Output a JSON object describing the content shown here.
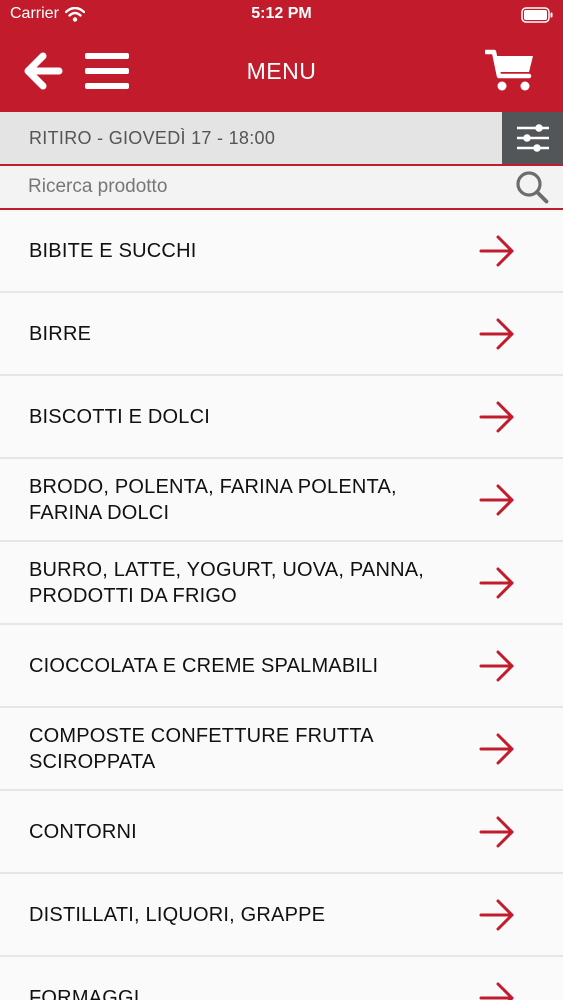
{
  "status_bar": {
    "carrier": "Carrier",
    "time": "5:12 PM"
  },
  "navbar": {
    "title": "MENU",
    "back_icon": "arrow-left-icon",
    "menu_icon": "hamburger-icon",
    "cart_icon": "cart-icon"
  },
  "pickup": {
    "text": "RITIRO - GIOVEDÌ 17 - 18:00"
  },
  "search": {
    "placeholder": "Ricerca prodotto",
    "value": ""
  },
  "colors": {
    "brand": "#c21c2c",
    "filter_bg": "#525659",
    "pickup_bg": "#e4e4e4"
  },
  "categories": [
    {
      "label": "BIBITE E SUCCHI"
    },
    {
      "label": "BIRRE"
    },
    {
      "label": "BISCOTTI E DOLCI"
    },
    {
      "label": "BRODO, POLENTA, FARINA POLENTA, FARINA DOLCI"
    },
    {
      "label": "BURRO, LATTE, YOGURT, UOVA, PANNA, PRODOTTI DA FRIGO"
    },
    {
      "label": "CIOCCOLATA E CREME SPALMABILI"
    },
    {
      "label": "COMPOSTE CONFETTURE FRUTTA SCIROPPATA"
    },
    {
      "label": "CONTORNI"
    },
    {
      "label": "DISTILLATI, LIQUORI, GRAPPE"
    },
    {
      "label": "FORMAGGI"
    }
  ]
}
